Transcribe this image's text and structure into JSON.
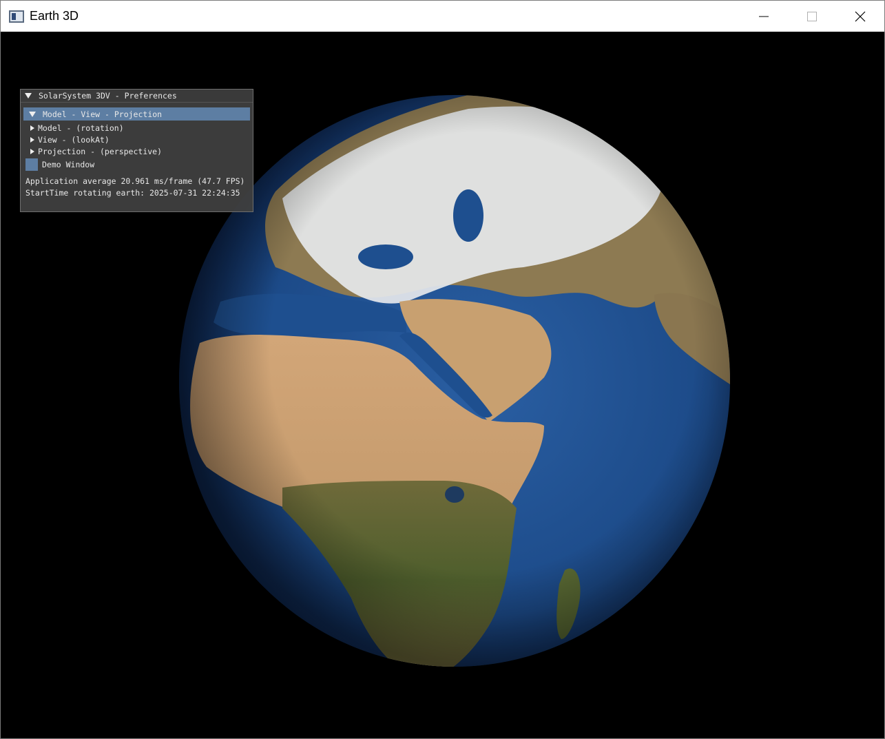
{
  "window": {
    "title": "Earth 3D",
    "icons": {
      "app": "app-window-icon",
      "minimize": "minimize-icon",
      "maximize": "maximize-icon",
      "close": "close-icon"
    }
  },
  "prefs_panel": {
    "title": "SolarSystem 3DV - Preferences",
    "section_header": "Model - View - Projection",
    "items": [
      {
        "label": "Model - (rotation)"
      },
      {
        "label": "View - (lookAt)"
      },
      {
        "label": "Projection - (perspective)"
      }
    ],
    "demo_window_label": "Demo Window",
    "info_fps": "Application average 20.961 ms/frame (47.7 FPS)",
    "info_start": "StartTime rotating earth: 2025-07-31 22:24:35"
  },
  "colors": {
    "header_accent": "#5d7ea3",
    "panel_bg": "#404040",
    "ocean": "#1e4f8f",
    "viewport_bg": "#000000"
  }
}
